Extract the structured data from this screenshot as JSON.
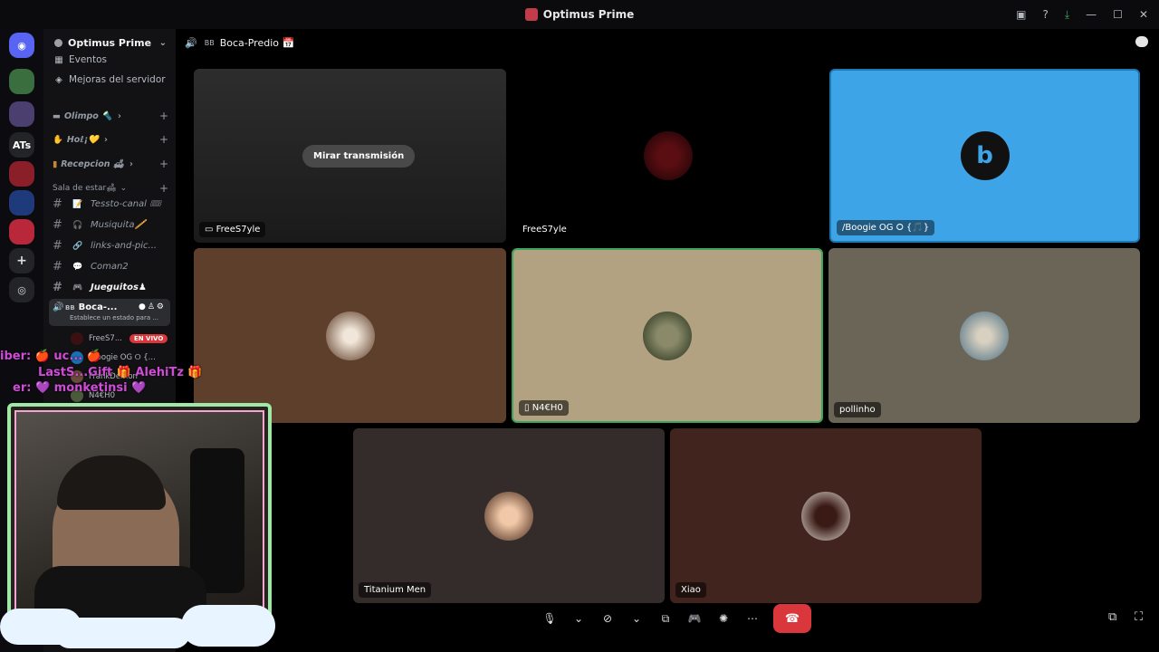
{
  "window": {
    "title": "Optimus Prime"
  },
  "server": {
    "name": "Optimus Prime"
  },
  "rail": {
    "servers": [
      "ATs"
    ]
  },
  "sidebar": {
    "top_items": [
      {
        "label": "Eventos",
        "icon": "calendar-icon"
      },
      {
        "label": "Mejoras del servidor",
        "icon": "boost-icon"
      }
    ],
    "categories": [
      {
        "label": "Olimpo 🔦"
      },
      {
        "label": "Hoℓ¡💛"
      },
      {
        "label": "Recepcion 🛋"
      }
    ],
    "section_label": "Sala de estar🛋",
    "channels": [
      {
        "emoji": "📝",
        "label": "Tessto-canal 🎟"
      },
      {
        "emoji": "🎧",
        "label": "Musiquita🪈"
      },
      {
        "emoji": "🔗",
        "label": "links-and-pic..."
      },
      {
        "emoji": "💬",
        "label": "Coman2"
      },
      {
        "emoji": "🎮",
        "label": "Jueguitos♟"
      }
    ],
    "voice_channel": {
      "prefix": "BB",
      "name": "Boca-...",
      "status_placeholder": "Establece un estado para ..."
    },
    "voice_users": [
      {
        "name": "FreeS7...",
        "badge": "EN VIVO"
      },
      {
        "name": "/Boogie OG ⭘ {...",
        "badge": ""
      },
      {
        "name": "FrankDemon",
        "badge": ""
      },
      {
        "name": "N4€H0",
        "badge": ""
      }
    ]
  },
  "header": {
    "prefix": "BB",
    "channel": "Boca-Predio 📅"
  },
  "tiles": {
    "stream": {
      "name": "FreeS7yle",
      "watch_label": "Mirar transmisión"
    },
    "camera": {
      "name": "FreeS7yle"
    },
    "boogie": {
      "name": "/Boogie OG ⭘ {🎵}"
    },
    "frank": {
      "name": ""
    },
    "n4echo": {
      "name": "N4€H0"
    },
    "pollinho": {
      "name": "pollinho"
    },
    "titanium": {
      "name": "Titanium Men"
    },
    "xiao": {
      "name": "Xiao"
    }
  },
  "overlay": {
    "line1": "iber: 🍎 uc... 🍎",
    "line2": "LastS...Gift 🎁 AlehiTz 🎁",
    "line3": "er: 💜 monketinsi 💜"
  },
  "colors": {
    "accent": "#5865f2",
    "hangup": "#da373c",
    "live": "#da373c",
    "boogie_tile": "#3ea4e8",
    "tile_brown": "#5e3f2c",
    "tile_tan": "#b2a282",
    "tile_gray": "#6a6557",
    "tile_dark": "#332c2b",
    "tile_maroon": "#41241d"
  }
}
